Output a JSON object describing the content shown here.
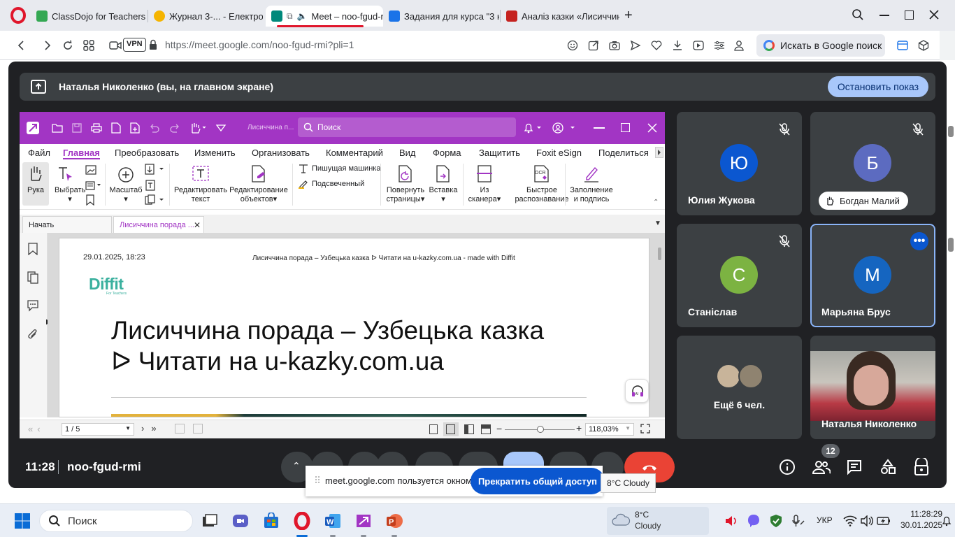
{
  "browser": {
    "tabs": [
      {
        "label": "ClassDojo for Teachers",
        "color": "#34a853"
      },
      {
        "label": "Журнал 3-... - Електронн",
        "color": "#f5b400"
      },
      {
        "label": "Meet – noo-fgud-r",
        "color": "#00897b",
        "active": true
      },
      {
        "label": "Задания для курса \"3 кла",
        "color": "#1a73e8"
      },
      {
        "label": "Аналіз казки «Лисиччина",
        "color": "#c5221f"
      }
    ],
    "url": "https://meet.google.com/noo-fgud-rmi?pli=1",
    "vpn_label": "VPN",
    "search_label": "Искать в Google поиск"
  },
  "meet": {
    "presenter_text": "Наталья Николенко (вы, на главном экране)",
    "stop_button": "Остановить показ",
    "time": "11:28",
    "meeting_code": "noo-fgud-rmi",
    "participant_count": "12",
    "share_notice": "meet.google.com пользуется окном.",
    "stop_share_button": "Прекратить общий доступ",
    "weather_tooltip": "8°C Cloudy",
    "participants": [
      {
        "name": "Юлия Жукова",
        "initial": "Ю",
        "color": "#0b57d0",
        "muted": true
      },
      {
        "name": "Богдан Малий",
        "initial": "Б",
        "color": "#5c6bc0",
        "muted": true
      },
      {
        "name": "Станіслав",
        "initial": "С",
        "color": "#7cb342",
        "muted": true
      },
      {
        "name": "Марьяна Брус",
        "initial": "М",
        "color": "#1565c0",
        "muted": false
      },
      {
        "name": "Ещё 6 чел."
      },
      {
        "name": "Наталья Николенко"
      }
    ]
  },
  "foxit": {
    "search_placeholder": "Поиск",
    "title_short": "Лисиччина п...",
    "menu": [
      "Файл",
      "Главная",
      "Преобразовать",
      "Изменить",
      "Организовать",
      "Комментарий",
      "Вид",
      "Форма",
      "Защитить",
      "Foxit eSign",
      "Поделиться"
    ],
    "ribbon": {
      "hand": "Рука",
      "select": "Выбрать",
      "zoom": "Масштаб",
      "edit_text_1": "Редактировать",
      "edit_text_2": "текст",
      "edit_obj_1": "Редактирование",
      "edit_obj_2": "объектов",
      "typewriter": "Пишущая машинка",
      "highlight": "Подсвеченный",
      "rotate_1": "Повернуть",
      "rotate_2": "страницы",
      "insert": "Вставка",
      "scanner_1": "Из",
      "scanner_2": "сканера",
      "ocr_1": "Быстрое",
      "ocr_2": "распознавание",
      "fill_1": "Заполнение",
      "fill_2": "и подпись"
    },
    "doc_tabs": [
      "Начать",
      "Лисиччина порада ..."
    ],
    "page": {
      "date": "29.01.2025, 18:23",
      "header": "Лисиччина порада – Узбецька казка ᐅ Читати на u-kazky.com.ua - made with Diffit",
      "logo": "Diffit",
      "logo_sub": "For Teachers",
      "title_line1": "Лисиччина порада – Узбецька казка",
      "title_line2": "ᐅ Читати на u-kazky.com.ua"
    },
    "status": {
      "page": "1 / 5",
      "zoom": "118,03%"
    }
  },
  "taskbar": {
    "search": "Поиск",
    "weather_temp": "8°C",
    "weather_desc": "Cloudy",
    "lang": "УКР",
    "clock_time": "11:28:29",
    "clock_date": "30.01.2025"
  }
}
